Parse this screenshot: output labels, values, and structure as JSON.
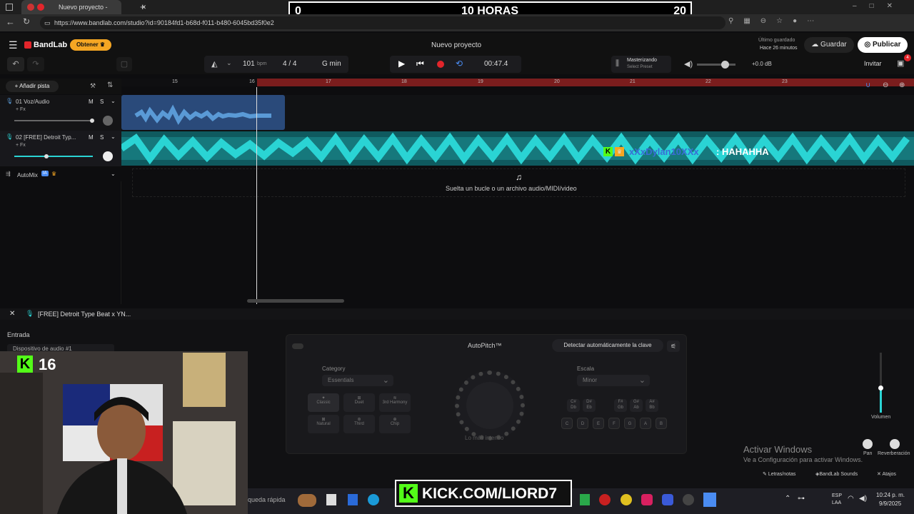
{
  "browser": {
    "tab_title": "Nuevo proyecto - Studio",
    "url": "https://www.bandlab.com/studio?id=90184fd1-b68d-f011-b480-6045bd35f0e2",
    "new_tab": "+"
  },
  "overlay": {
    "score_left": "0",
    "score_center": "10 HORAS",
    "score_right": "20",
    "sub_count": "16",
    "chat_user": "xXxDylan10XXx",
    "chat_msg": ": HAHAHHA",
    "kick_url": "KICK.COM/LIORD7"
  },
  "app": {
    "brand": "BandLab",
    "obtener": "Obtener",
    "project_title": "Nuevo proyecto",
    "last_saved_label": "Último guardado",
    "last_saved_time": "Hace 26 minutos",
    "save": "Guardar",
    "publish": "Publicar",
    "invite": "Invitar",
    "notif_count": "4"
  },
  "toolbar": {
    "bpm": "101",
    "bpm_unit": "bpm",
    "time_sig": "4 / 4",
    "key": "G min",
    "time": "00:47.4",
    "mastering_title": "Masterizando",
    "mastering_sub": "Select Preset",
    "db": "+0.0 dB"
  },
  "tracks": {
    "add_track": "Añadir pista",
    "t1_name": "01  Voz/Audio",
    "t2_name": "02  [FREE] Detroit Typ...",
    "fx": "+ Fx",
    "mute": "M",
    "solo": "S",
    "automix": "AutoMix",
    "ia": "IA",
    "drop_hint": "Suelta un bucle o un archivo audio/MIDI/video"
  },
  "ruler": {
    "ticks": [
      "15",
      "16",
      "17",
      "18",
      "19",
      "20",
      "21",
      "22",
      "23"
    ]
  },
  "bottom": {
    "track_name": "[FREE] Detroit Type Beat x YN...",
    "entrada": "Entrada",
    "device": "Dispositivo de audio #1",
    "autopitch": "AutoPitch™",
    "detect_key": "Detectar automáticamente la clave",
    "category_label": "Category",
    "category_value": "Essentials",
    "scale_label": "Escala",
    "scale_value": "Minor",
    "knob_label": "Lo más intenso",
    "presets": [
      "Classic",
      "Duet",
      "3rd Harmony",
      "Natural",
      "Third",
      "Chip"
    ],
    "notes": [
      "C",
      "D",
      "E",
      "F",
      "G",
      "A",
      "B"
    ],
    "sharps": [
      "C#\nDb",
      "D#\nEb",
      "F#\nGb",
      "G#\nAb",
      "A#\nBb"
    ],
    "volume": "Volumen",
    "pan": "Pan",
    "reverb": "Reverberación",
    "lyrics": "Letras/notas",
    "sounds": "BandLab Sounds",
    "shortcuts": "Atajos"
  },
  "windows": {
    "activate": "Activar Windows",
    "activate_sub": "Ve a Configuración para activar Windows.",
    "search": "queda rápida",
    "lang": "ESP\nLAA",
    "clock_time": "10:24 p. m.",
    "clock_date": "9/9/2025"
  },
  "colors": {
    "accent_red": "#e2252b",
    "waveform_cyan": "#2ad4d4",
    "voice_blue": "#5a9ad6",
    "obtener": "#f5a623",
    "kick_green": "#53fc18"
  }
}
